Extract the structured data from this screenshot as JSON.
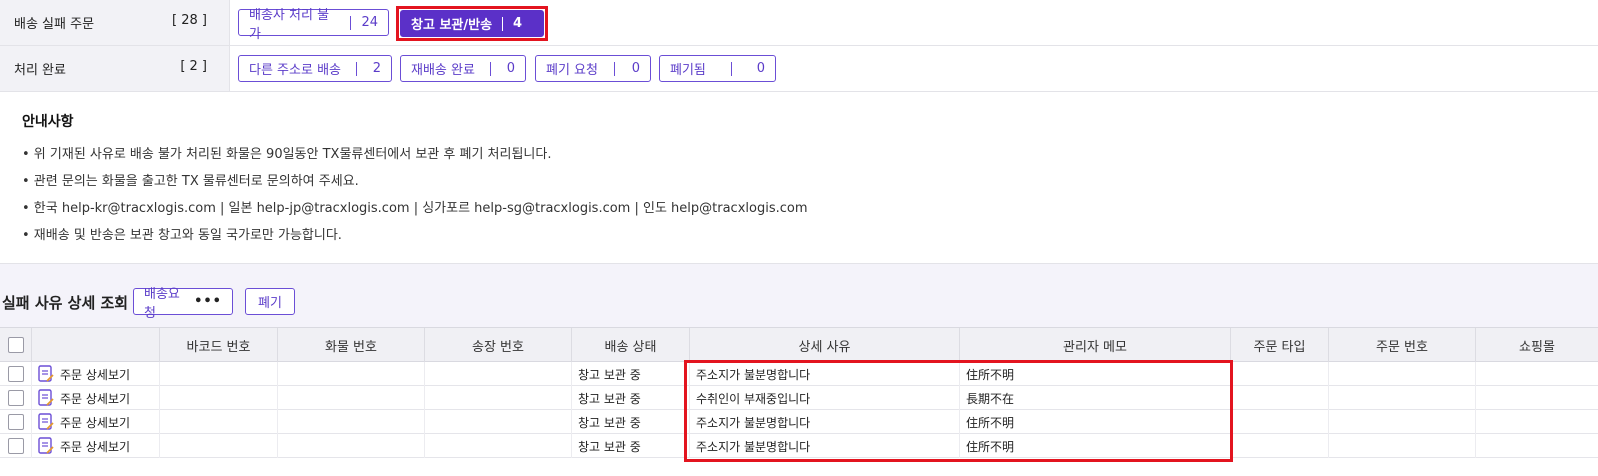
{
  "status": {
    "failed": {
      "label": "배송 실패 주문",
      "count": "[ 28 ]",
      "filters": [
        {
          "label": "배송사 처리 불가",
          "count": "24"
        },
        {
          "label": "창고 보관/반송",
          "count": "4"
        }
      ]
    },
    "done": {
      "label": "처리 완료",
      "count": "[ 2 ]",
      "filters": [
        {
          "label": "다른 주소로 배송",
          "count": "2"
        },
        {
          "label": "재배송 완료",
          "count": "0"
        },
        {
          "label": "폐기 요청",
          "count": "0"
        },
        {
          "label": "폐기됨",
          "count": "0"
        }
      ]
    }
  },
  "notice": {
    "title": "안내사항",
    "lines": [
      "• 위 기재된 사유로 배송 불가 처리된 화물은 90일동안 TX물류센터에서 보관 후 폐기 처리됩니다.",
      "• 관련 문의는 화물을 출고한 TX 물류센터로 문의하여 주세요.",
      "• 한국 help-kr@tracxlogis.com | 일본 help-jp@tracxlogis.com | 싱가포르 help-sg@tracxlogis.com | 인도 help@tracxlogis.com",
      "• 재배송 및 반송은 보관 창고와 동일 국가로만 가능합니다."
    ]
  },
  "detail": {
    "title": "실패 사유 상세 조회",
    "ship_request_label": "배송요청",
    "more_label": "•••",
    "discard_label": "폐기"
  },
  "table": {
    "columns": [
      "바코드 번호",
      "화물 번호",
      "송장 번호",
      "배송 상태",
      "상세 사유",
      "관리자 메모",
      "주문 타입",
      "주문 번호",
      "쇼핑몰"
    ],
    "rows": [
      {
        "link": "주문 상세보기",
        "status": "창고 보관 중",
        "reason": "주소지가 불분명합니다",
        "memo": "住所不明"
      },
      {
        "link": "주문 상세보기",
        "status": "창고 보관 중",
        "reason": "수취인이 부재중입니다",
        "memo": "長期不在"
      },
      {
        "link": "주문 상세보기",
        "status": "창고 보관 중",
        "reason": "주소지가 불분명합니다",
        "memo": "住所不明"
      },
      {
        "link": "주문 상세보기",
        "status": "창고 보관 중",
        "reason": "주소지가 불분명합니다",
        "memo": "住所不明"
      }
    ]
  },
  "colors": {
    "accent": "#5b30c8",
    "highlight": "#e3141f"
  }
}
